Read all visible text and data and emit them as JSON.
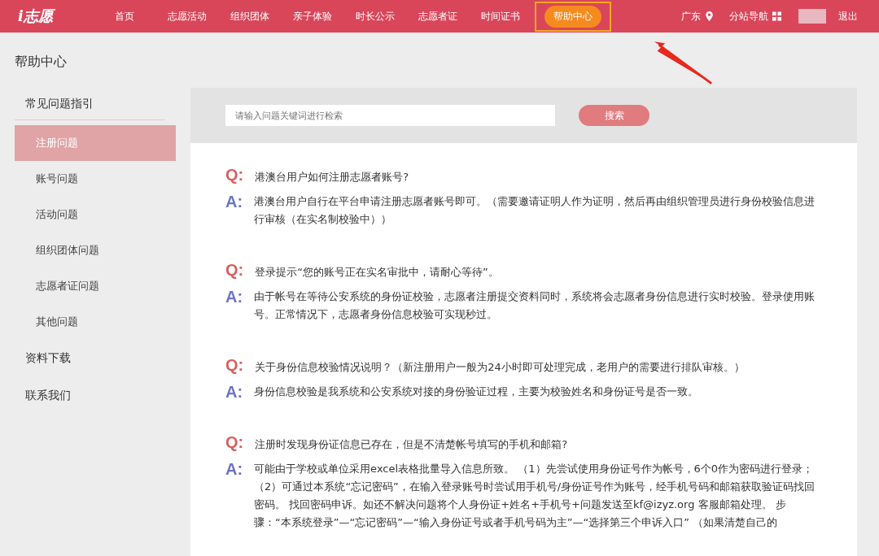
{
  "header": {
    "logo": "i志愿",
    "nav": [
      {
        "label": "首页",
        "selected": false
      },
      {
        "label": "志愿活动",
        "selected": false
      },
      {
        "label": "组织团体",
        "selected": false
      },
      {
        "label": "亲子体验",
        "selected": false
      },
      {
        "label": "时长公示",
        "selected": false
      },
      {
        "label": "志愿者证",
        "selected": false
      },
      {
        "label": "时间证书",
        "selected": false
      },
      {
        "label": "帮助中心",
        "selected": true
      }
    ],
    "region": "广东",
    "site_nav": "分站导航",
    "logout": "退出"
  },
  "sidebar": {
    "title": "帮助中心",
    "sections": [
      {
        "label": "常见问题指引",
        "children": [
          {
            "label": "注册问题",
            "selected": true
          },
          {
            "label": "账号问题",
            "selected": false
          },
          {
            "label": "活动问题",
            "selected": false
          },
          {
            "label": "组织团体问题",
            "selected": false
          },
          {
            "label": "志愿者证问题",
            "selected": false
          },
          {
            "label": "其他问题",
            "selected": false
          }
        ]
      },
      {
        "label": "资料下载"
      },
      {
        "label": "联系我们"
      }
    ]
  },
  "search": {
    "placeholder": "请输入问题关键词进行检索",
    "button": "搜索"
  },
  "faq": [
    {
      "q_mark": "Q:",
      "question": "港澳台用户如何注册志愿者账号?",
      "a_mark": "A:",
      "answer": "港澳台用户自行在平台申请注册志愿者账号即可。（需要邀请证明人作为证明，然后再由组织管理员进行身份校验信息进行审核（在实名制校验中））"
    },
    {
      "q_mark": "Q:",
      "question": "登录提示“您的账号正在实名审批中，请耐心等待”。",
      "a_mark": "A:",
      "answer": "由于帐号在等待公安系统的身份证校验，志愿者注册提交资料同时，系统将会志愿者身份信息进行实时校验。登录使用账号。正常情况下，志愿者身份信息校验可实现秒过。"
    },
    {
      "q_mark": "Q:",
      "question": "关于身份信息校验情况说明？（新注册用户一般为24小时即可处理完成，老用户的需要进行排队审核。）",
      "a_mark": "A:",
      "answer": "身份信息校验是我系统和公安系统对接的身份验证过程，主要为校验姓名和身份证号是否一致。"
    },
    {
      "q_mark": "Q:",
      "question": "注册时发现身份证信息已存在，但是不清楚帐号填写的手机和邮箱?",
      "a_mark": "A:",
      "answer": "可能由于学校或单位采用excel表格批量导入信息所致。 （1）先尝试使用身份证号作为帐号，6个0作为密码进行登录；（2）可通过本系统“忘记密码”，在输入登录账号时尝试用手机号/身份证号作为账号，经手机号码和邮箱获取验证码找回密码。 找回密码申诉。如还不解决问题将个人身份证+姓名+手机号+问题发送至kf@izyz.org 客服邮箱处理。 步骤：“本系统登录”—“忘记密码”—“输入身份证号或者手机号码为主”—“选择第三个申诉入口” （如果清楚自己的"
    }
  ]
}
